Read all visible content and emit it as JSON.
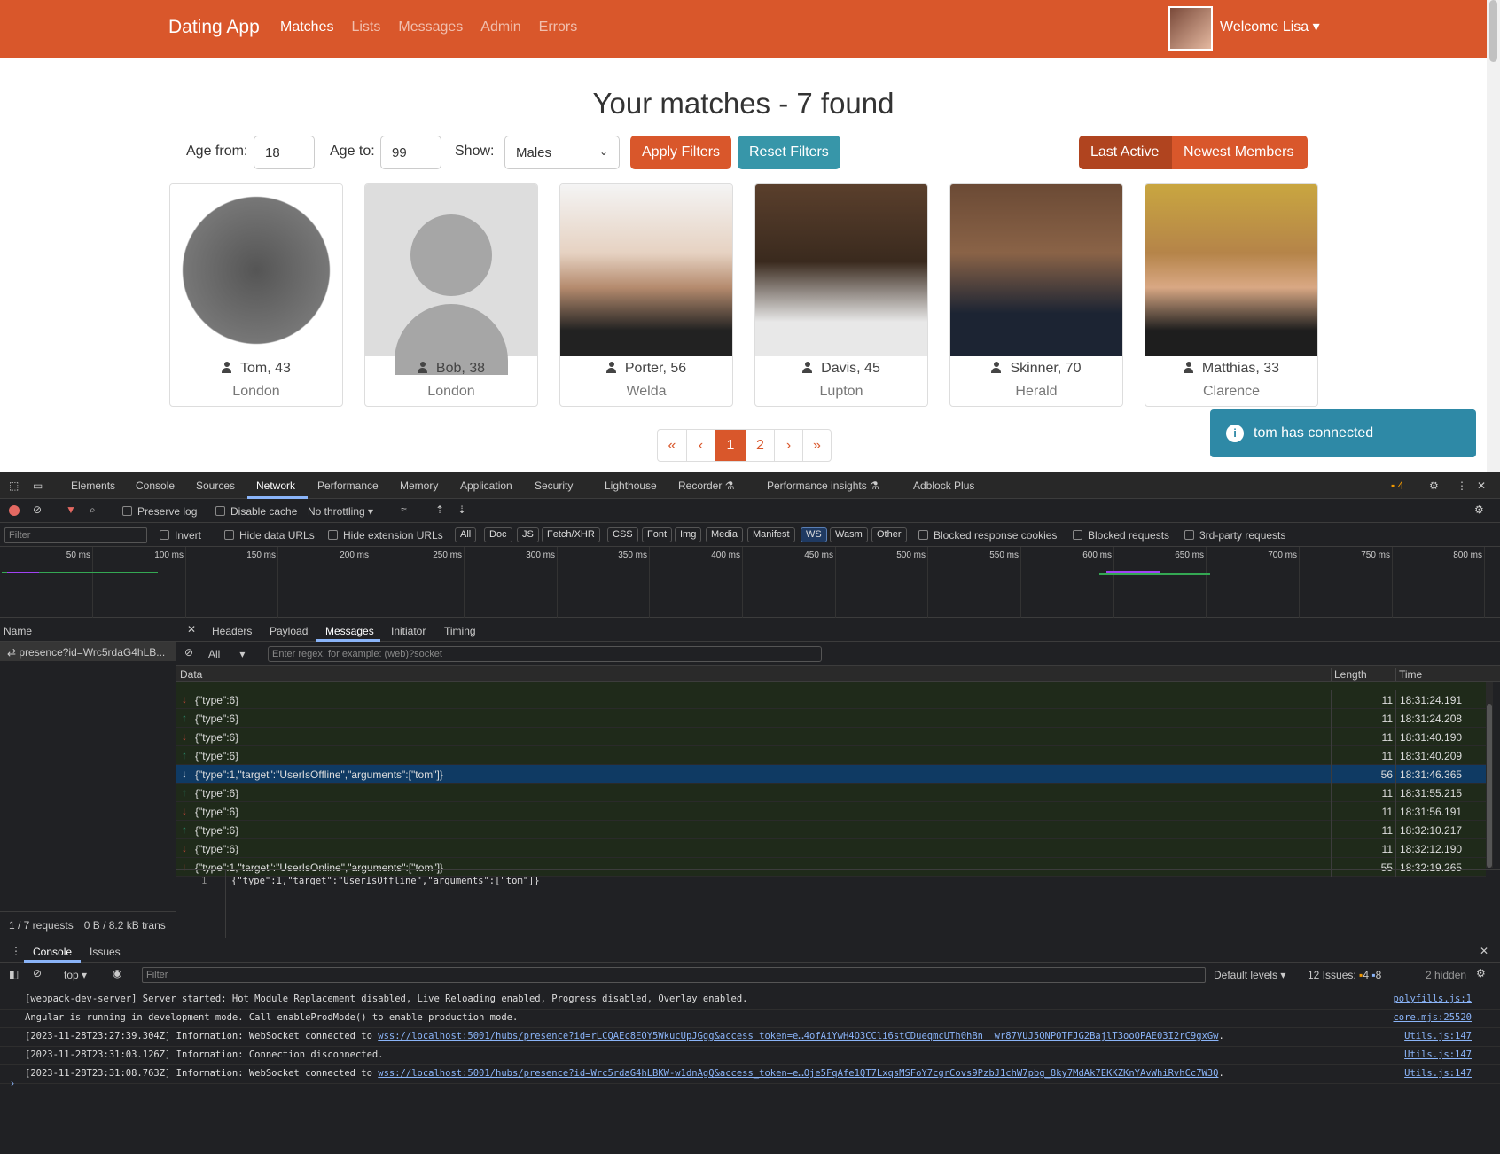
{
  "navbar": {
    "brand": "Dating App",
    "links": [
      "Matches",
      "Lists",
      "Messages",
      "Admin",
      "Errors"
    ],
    "welcome": "Welcome Lisa ▾"
  },
  "page": {
    "title": "Your matches - 7 found",
    "filters": {
      "age_from_label": "Age from:",
      "age_from": "18",
      "age_to_label": "Age to:",
      "age_to": "99",
      "show_label": "Show:",
      "show_value": "Males",
      "apply": "Apply Filters",
      "reset": "Reset Filters"
    },
    "sort": {
      "last_active": "Last Active",
      "newest": "Newest Members"
    },
    "members": [
      {
        "name": "Tom, 43",
        "city": "London"
      },
      {
        "name": "Bob, 38",
        "city": "London"
      },
      {
        "name": "Porter, 56",
        "city": "Welda"
      },
      {
        "name": "Davis, 45",
        "city": "Lupton"
      },
      {
        "name": "Skinner, 70",
        "city": "Herald"
      },
      {
        "name": "Matthias, 33",
        "city": "Clarence"
      }
    ],
    "pagination": [
      "«",
      "‹",
      "1",
      "2",
      "›",
      "»"
    ],
    "toast": "tom has connected"
  },
  "devtools": {
    "tabs": [
      "Elements",
      "Console",
      "Sources",
      "Network",
      "Performance",
      "Memory",
      "Application",
      "Security",
      "Lighthouse",
      "Recorder ⚗",
      "Performance insights ⚗",
      "Adblock Plus"
    ],
    "issues_badge": "4",
    "toolbar": {
      "preserve": "Preserve log",
      "disable_cache": "Disable cache",
      "throttling": "No throttling"
    },
    "filterbar": {
      "placeholder": "Filter",
      "invert": "Invert",
      "hide_data": "Hide data URLs",
      "hide_ext": "Hide extension URLs",
      "types": [
        "All",
        "Doc",
        "JS",
        "Fetch/XHR",
        "CSS",
        "Font",
        "Img",
        "Media",
        "Manifest",
        "WS",
        "Wasm",
        "Other"
      ],
      "blocked_cookies": "Blocked response cookies",
      "blocked_req": "Blocked requests",
      "third_party": "3rd-party requests"
    },
    "timeline_ticks": [
      "50 ms",
      "100 ms",
      "150 ms",
      "200 ms",
      "250 ms",
      "300 ms",
      "350 ms",
      "400 ms",
      "450 ms",
      "500 ms",
      "550 ms",
      "600 ms",
      "650 ms",
      "700 ms",
      "750 ms",
      "800 ms"
    ],
    "side": {
      "header": "Name",
      "request": "presence?id=Wrc5rdaG4hLB...",
      "footer1": "1 / 7 requests",
      "footer2": "0 B / 8.2 kB trans"
    },
    "detail_tabs": [
      "Headers",
      "Payload",
      "Messages",
      "Initiator",
      "Timing"
    ],
    "msg_filter": {
      "scope": "All",
      "placeholder": "Enter regex, for example: (web)?socket"
    },
    "columns": {
      "data": "Data",
      "length": "Length",
      "time": "Time"
    },
    "messages": [
      {
        "dir": "down",
        "data": "{\"type\":6}",
        "length": "11",
        "time": "18:31:24.191"
      },
      {
        "dir": "up",
        "data": "{\"type\":6}",
        "length": "11",
        "time": "18:31:24.208"
      },
      {
        "dir": "down",
        "data": "{\"type\":6}",
        "length": "11",
        "time": "18:31:40.190"
      },
      {
        "dir": "up",
        "data": "{\"type\":6}",
        "length": "11",
        "time": "18:31:40.209"
      },
      {
        "dir": "down",
        "data": "{\"type\":1,\"target\":\"UserIsOffline\",\"arguments\":[\"tom\"]}",
        "length": "56",
        "time": "18:31:46.365",
        "selected": true
      },
      {
        "dir": "up",
        "data": "{\"type\":6}",
        "length": "11",
        "time": "18:31:55.215"
      },
      {
        "dir": "down",
        "data": "{\"type\":6}",
        "length": "11",
        "time": "18:31:56.191"
      },
      {
        "dir": "up",
        "data": "{\"type\":6}",
        "length": "11",
        "time": "18:32:10.217"
      },
      {
        "dir": "down",
        "data": "{\"type\":6}",
        "length": "11",
        "time": "18:32:12.190"
      },
      {
        "dir": "down",
        "data": "{\"type\":1,\"target\":\"UserIsOnline\",\"arguments\":[\"tom\"]}",
        "length": "55",
        "time": "18:32:19.265"
      }
    ],
    "preview": {
      "line": "1",
      "text": "{\"type\":1,\"target\":\"UserIsOffline\",\"arguments\":[\"tom\"]}"
    },
    "console": {
      "tabs": [
        "Console",
        "Issues"
      ],
      "context": "top",
      "filter_placeholder": "Filter",
      "levels": "Default levels ▾",
      "issues": "12 Issues:",
      "issues_warn": "4",
      "issues_info": "8",
      "hidden": "2 hidden",
      "logs": [
        {
          "text": "[webpack-dev-server] Server started: Hot Module Replacement disabled, Live Reloading enabled, Progress disabled, Overlay enabled.",
          "link": "",
          "src": "polyfills.js:1"
        },
        {
          "text": "Angular is running in development mode. Call enableProdMode() to enable production mode.",
          "link": "",
          "src": "core.mjs:25520"
        },
        {
          "text": "[2023-11-28T23:27:39.304Z] Information: WebSocket connected to ",
          "link": "wss://localhost:5001/hubs/presence?id=rLCQAEc8EOY5WkucUpJGgg&access_token=e…4ofAiYwH4O3CCli6stCDueqmcUTh0hBn__wr87VUJ5QNPOTFJG2BajlT3ooOPAE03I2rC9gxGw",
          "src": "Utils.js:147"
        },
        {
          "text": "[2023-11-28T23:31:03.126Z] Information: Connection disconnected.",
          "link": "",
          "src": "Utils.js:147"
        },
        {
          "text": "[2023-11-28T23:31:08.763Z] Information: WebSocket connected to ",
          "link": "wss://localhost:5001/hubs/presence?id=Wrc5rdaG4hLBKW-w1dnAgQ&access_token=e…Oje5FqAfe1QT7LxqsMSFoY7cgrCovs9PzbJ1chW7pbg_8ky7MdAk7EKKZKnYAvWhiRvhCc7W3Q",
          "src": "Utils.js:147"
        }
      ]
    }
  }
}
